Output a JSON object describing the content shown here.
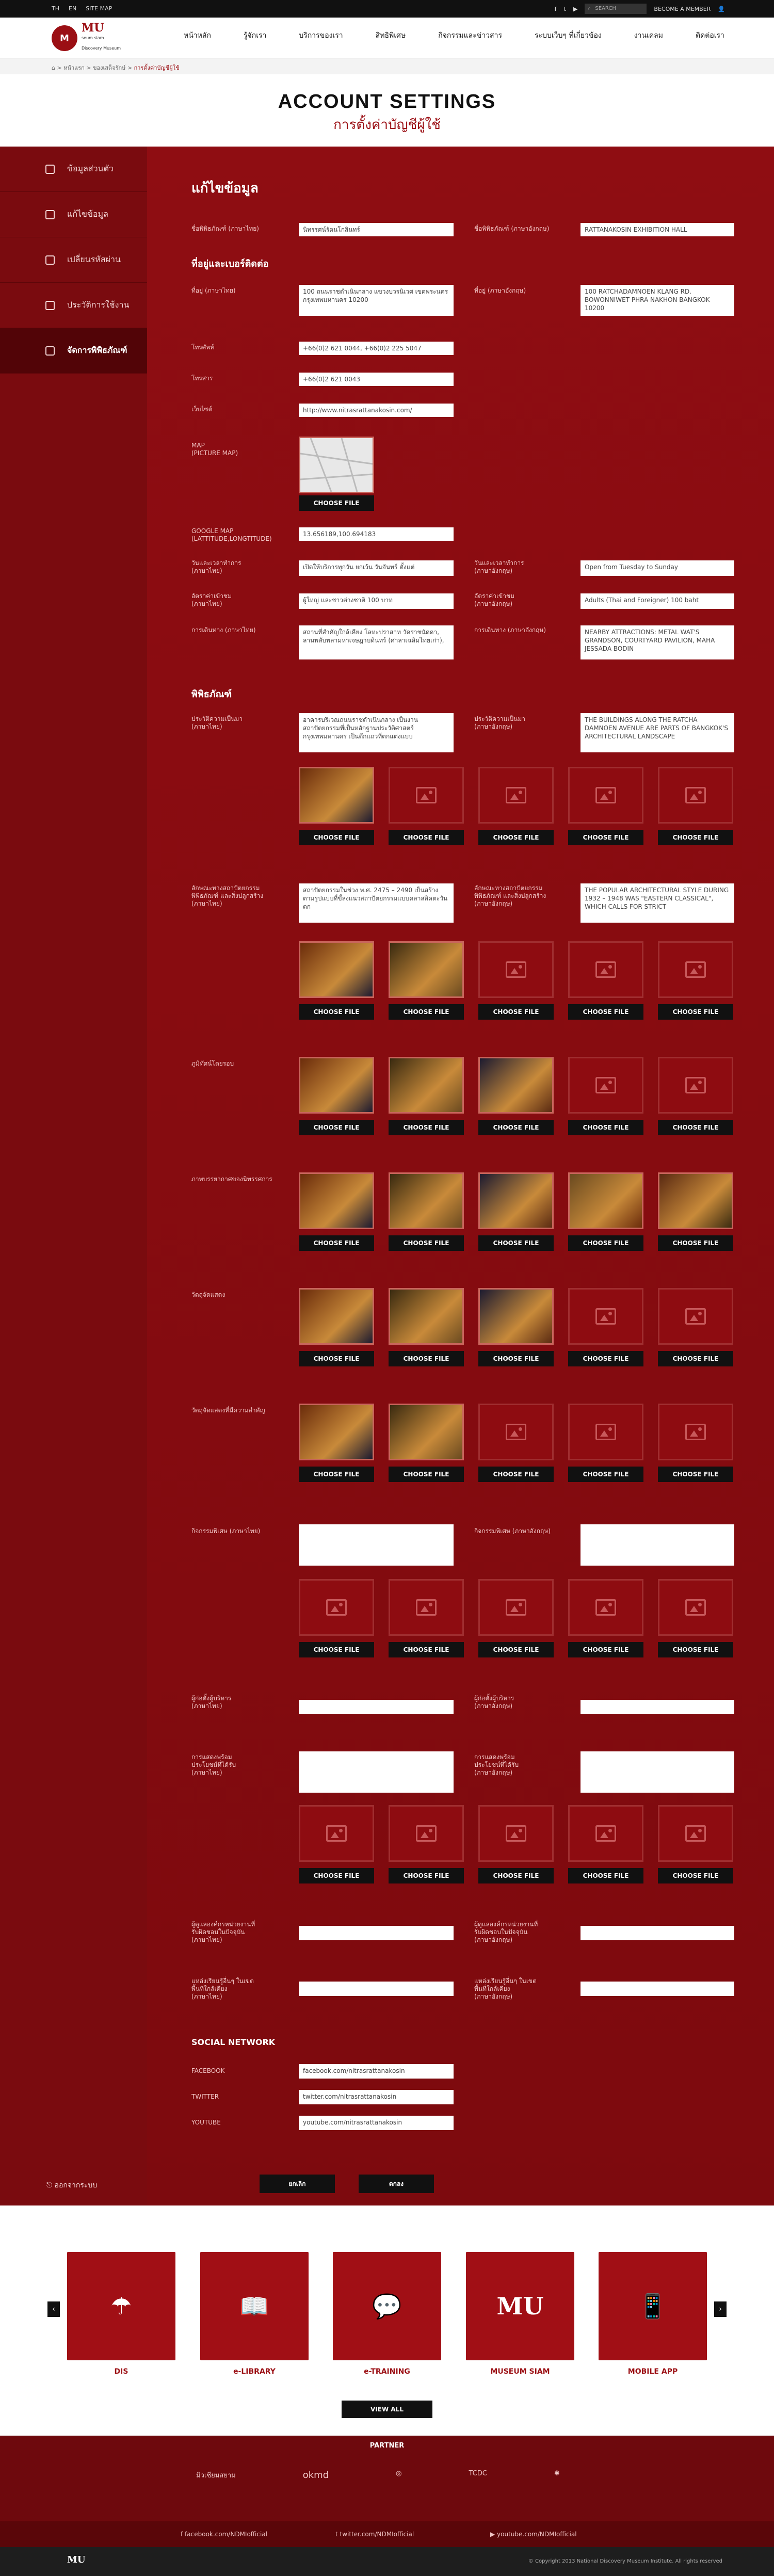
{
  "topbar": {
    "lang_th": "TH",
    "lang_en": "EN",
    "sitemap": "SITE MAP",
    "search_placeholder": "SEARCH",
    "member": "BECOME A MEMBER"
  },
  "logo": {
    "mark": "M",
    "name": "MU",
    "name2": "seum siam",
    "sub": "Discovery Museum"
  },
  "nav": [
    "หน้าหลัก",
    "รู้จักเรา",
    "บริการของเรา",
    "สิทธิพิเศษ",
    "กิจกรรมและข่าวสาร",
    "ระบบเว็บๆ ที่เกี่ยวข้อง",
    "งานเคลม",
    "ติดต่อเรา"
  ],
  "breadcrumb": {
    "home": "หน้าแรก",
    "mid": "ของเสด็จรักษ์",
    "current": "การตั้งค่าบัญชีผู้ใช้"
  },
  "title": {
    "en": "ACCOUNT SETTINGS",
    "th": "การตั้งค่าบัญชีผู้ใช้"
  },
  "sidebar": {
    "items": [
      {
        "label": "ข้อมูลส่วนตัว",
        "icon": "user-icon"
      },
      {
        "label": "แก้ไขข้อมูล",
        "icon": "edit-icon"
      },
      {
        "label": "เปลี่ยนรหัสผ่าน",
        "icon": "lock-icon"
      },
      {
        "label": "ประวัติการใช้งาน",
        "icon": "history-icon"
      },
      {
        "label": "จัดการพิพิธภัณฑ์",
        "icon": "museum-icon"
      }
    ],
    "logout": "ออกจากระบบ"
  },
  "form": {
    "heading": "แก้ไขข้อมูล",
    "name_th_label": "ชื่อพิพิธภัณฑ์ (ภาษาไทย)",
    "name_th": "นิทรรศน์รัตนโกสินทร์",
    "name_en_label": "ชื่อพิพิธภัณฑ์ (ภาษาอังกฤษ)",
    "name_en": "RATTANAKOSIN EXHIBITION HALL",
    "contact_heading": "ที่อยู่และเบอร์ติดต่อ",
    "addr_th_label": "ที่อยู่ (ภาษาไทย)",
    "addr_th": "100 ถนนราชดำเนินกลาง แขวงบวรนิเวศ เขตพระนคร กรุงเทพมหานคร 10200",
    "addr_en_label": "ที่อยู่ (ภาษาอังกฤษ)",
    "addr_en": "100 RATCHADAMNOEN KLANG RD. BOWONNIWET PHRA NAKHON BANGKOK 10200",
    "phone_label": "โทรศัพท์",
    "phone": "+66(0)2 621 0044, +66(0)2 225 5047",
    "fax_label": "โทรสาร",
    "fax": "+66(0)2 621 0043",
    "web_label": "เว็บไซต์",
    "web": "http://www.nitrasrattanakosin.com/",
    "map_label": "MAP\n(PICTURE MAP)",
    "choose": "CHOOSE FILE",
    "gmap_label": "GOOGLE MAP\n(LATTITUDE,LONGTITUDE)",
    "gmap": "13.656189,100.694183",
    "open_th_label": "วันและเวลาทำการ\n(ภาษาไทย)",
    "open_th": "เปิดให้บริการทุกวัน ยกเว้น วันจันทร์ ตั้งแต่",
    "open_en_label": "วันและเวลาทำการ\n(ภาษาอังกฤษ)",
    "open_en": "Open from Tuesday to Sunday",
    "fee_th_label": "อัตราค่าเข้าชม\n(ภาษาไทย)",
    "fee_th": "ผู้ใหญ่ และชาวต่างชาติ 100 บาท",
    "fee_en_label": "อัตราค่าเข้าชม\n(ภาษาอังกฤษ)",
    "fee_en": "Adults (Thai and Foreigner) 100 baht",
    "attr_th_label": "การเดินทาง (ภาษาไทย)",
    "attr_th": "สถานที่สำคัญใกล้เคียง โลหะปราสาท วัดราชนัดดา, ลานพลับพลามหาเจษฎาบดินทร์ (ศาลาเฉลิมไทยเก่า),",
    "attr_en_label": "การเดินทาง (ภาษาอังกฤษ)",
    "attr_en": "NEARBY ATTRACTIONS: METAL WAT'S GRANDSON, COURTYARD PAVILION, MAHA JESSADA BODIN",
    "museum_heading": "พิพิธภัณฑ์",
    "hist_th_label": "ประวัติความเป็นมา\n(ภาษาไทย)",
    "hist_th": "อาคารบริเวณถนนราชดำเนินกลาง เป็นงานสถาปัตยกรรมที่เป็นหลักฐานประวัติศาสตร์ กรุงเทพมหานคร เป็นตึกแถวที่ตกแต่งแบบ",
    "hist_en_label": "ประวัติความเป็นมา\n(ภาษาอังกฤษ)",
    "hist_en": "THE BUILDINGS ALONG THE RATCHA DAMNOEN AVENUE ARE PARTS OF BANGKOK'S ARCHITECTURAL LANDSCAPE",
    "arch_th_label": "ลักษณะทางสถาปัตยกรรม\nพิพิธภัณฑ์ และสิ่งปลูกสร้าง\n(ภาษาไทย)",
    "arch_th": "สถาปัตยกรรมในช่วง พ.ศ. 2475 – 2490 เป็นสร้างตามรูปแบบที่ขึ้ลงแนวสถาปัตยกรรมแบบคลาสสิคตะวันตก",
    "arch_en_label": "ลักษณะทางสถาปัตยกรรม\nพิพิธภัณฑ์ และสิ่งปลูกสร้าง\n(ภาษาอังกฤษ)",
    "arch_en": "THE POPULAR ARCHITECTURAL STYLE DURING 1932 – 1948 WAS \"EASTERN CLASSICAL\", WHICH CALLS FOR STRICT",
    "landscape_label": "ภูมิทัศน์โดยรอบ",
    "exhibit_label": "ภาพบรรยากาศของนิทรรศการ",
    "objects_label": "วัตถุจัดแสดง",
    "key_objects_label": "วัตถุจัดแสดงที่มีความสำคัญ",
    "activity_th_label": "กิจกรรมพิเศษ (ภาษาไทย)",
    "activity_en_label": "กิจกรรมพิเศษ (ภาษาอังกฤษ)",
    "owner_th_label": "ผู้ก่อตั้งผู้บริหาร\n(ภาษาไทย)",
    "owner_en_label": "ผู้ก่อตั้งผู้บริหาร\n(ภาษาอังกฤษ)",
    "impress_th_label": "การแสดงพร้อม\nประโยชน์ที่ได้รับ\n(ภาษาไทย)",
    "impress_en_label": "การแสดงพร้อม\nประโยชน์ที่ได้รับ\n(ภาษาอังกฤษ)",
    "agency_th_label": "ผู้ดูแลองค์กรหน่วยงานที่\nรับผิดชอบในปัจจุบัน\n(ภาษาไทย)",
    "agency_en_label": "ผู้ดูแลองค์กรหน่วยงานที่\nรับผิดชอบในปัจจุบัน\n(ภาษาอังกฤษ)",
    "note_th_label": "แหล่งเรียนรู้อื่นๆ ในเขต\nพื้นที่ใกล้เคียง\n(ภาษาไทย)",
    "note_en_label": "แหล่งเรียนรู้อื่นๆ ในเขต\nพื้นที่ใกล้เคียง\n(ภาษาอังกฤษ)",
    "social_heading": "SOCIAL NETWORK",
    "fb_label": "FACEBOOK",
    "fb": "facebook.com/nitrasrattanakosin",
    "tw_label": "TWITTER",
    "tw": "twitter.com/nitrasrattanakosin",
    "yt_label": "YOUTUBE",
    "yt": "youtube.com/nitrasrattanakosin",
    "cancel": "ยกเลิก",
    "save": "ตกลง"
  },
  "cards": [
    {
      "label": "DIS",
      "icon": "dis-icon"
    },
    {
      "label": "e-LIBRARY",
      "icon": "book-icon"
    },
    {
      "label": "e-TRAINING",
      "icon": "training-icon"
    },
    {
      "label": "MUSEUM SIAM",
      "icon": "museum-siam-icon"
    },
    {
      "label": "MOBILE APP",
      "icon": "mobile-icon"
    }
  ],
  "view_all": "VIEW ALL",
  "partner_heading": "PARTNER",
  "partners": [
    "มิวเซียมสยาม",
    "okmd",
    "",
    "TCDC",
    ""
  ],
  "social_footer": {
    "fb": "facebook.com/NDMIofficial",
    "tw": "twitter.com/NDMIofficial",
    "yt": "youtube.com/NDMIofficial"
  },
  "copyright": "© Copyright 2013 National Discovery Museum Institute. All rights reserved",
  "colors": {
    "brand": "#9b0f14",
    "sidebar": "#7a0b0f",
    "main": "#8f0d12"
  }
}
